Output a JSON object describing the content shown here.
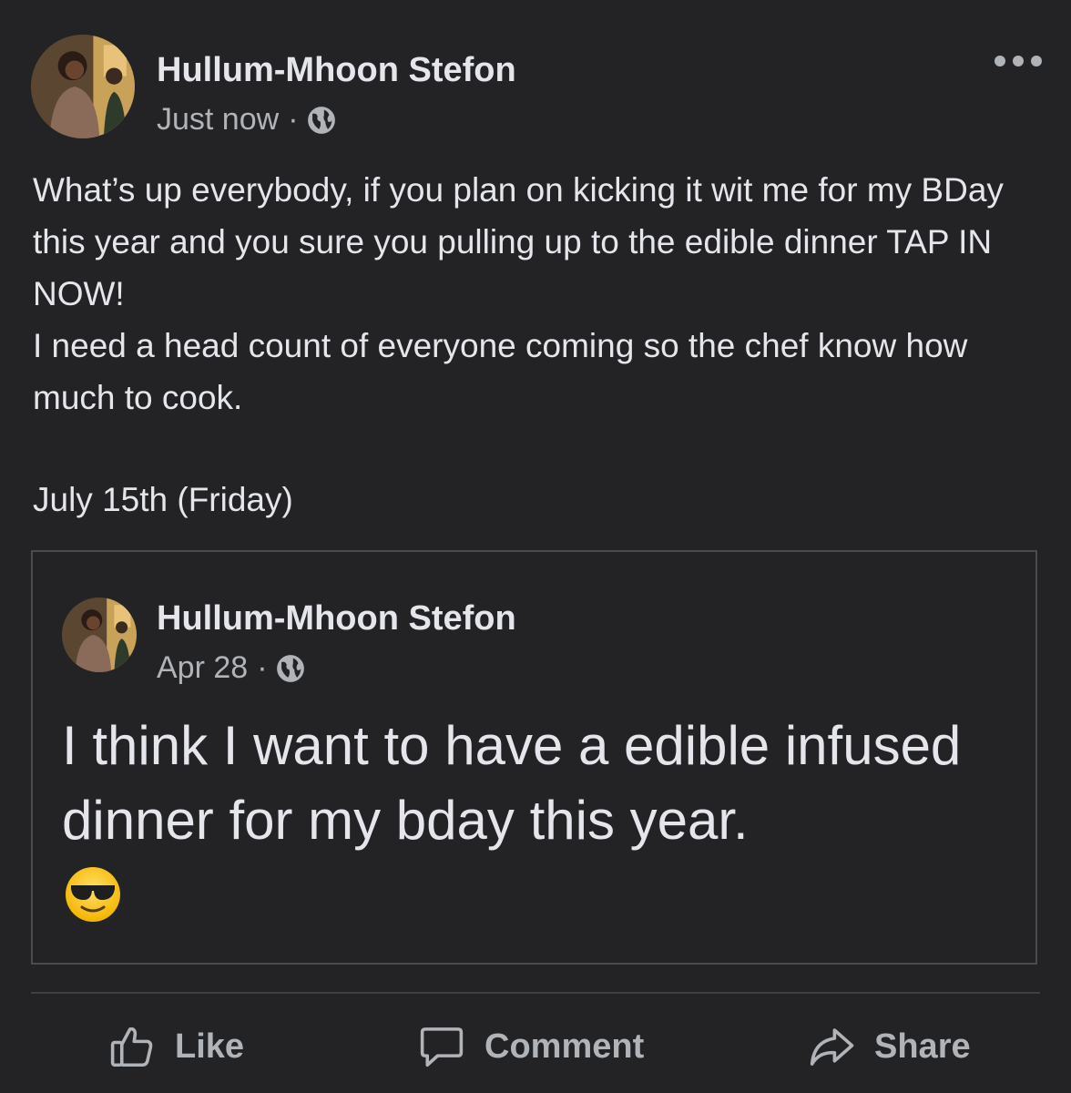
{
  "post": {
    "author": "Hullum-Mhoon Stefon",
    "time": "Just now",
    "separator": "·",
    "privacy_icon": "globe-icon",
    "more_icon": "more-options-icon",
    "text_lines": [
      "What’s up everybody, if you plan on kicking it wit me for my BDay this year and you sure you pulling up to the edible dinner TAP IN NOW!",
      "I need a head count of everyone coming so the chef know how much to cook."
    ],
    "date_line": "July 15th (Friday)"
  },
  "shared_post": {
    "author": "Hullum-Mhoon Stefon",
    "time": "Apr 28",
    "separator": "·",
    "privacy_icon": "globe-icon",
    "text": "I think I want to have a edible infused dinner for my bday this year.",
    "emoji": "smiling-face-with-sunglasses-emoji"
  },
  "actions": {
    "like": "Like",
    "comment": "Comment",
    "share": "Share"
  },
  "colors": {
    "background": "#232325",
    "primary_text": "#e4e6eb",
    "secondary_text": "#b0b3b8",
    "border": "#4a4b4e"
  }
}
